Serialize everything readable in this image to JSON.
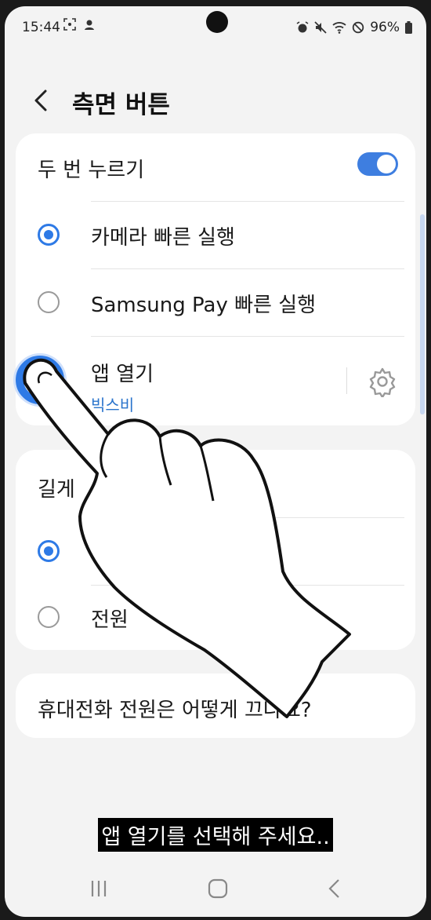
{
  "status_bar": {
    "time": "15:44",
    "left_icons": [
      "screenshot-icon",
      "bixby-icon"
    ],
    "right_icons": [
      "alarm-icon",
      "mute-icon",
      "wifi-icon",
      "do-not-disturb-icon"
    ],
    "battery_text": "96%"
  },
  "header": {
    "title": "측면 버튼"
  },
  "double_press": {
    "title": "두 번 누르기",
    "toggle_on": true,
    "options": [
      {
        "label": "카메라 빠른 실행",
        "selected": false
      },
      {
        "label": "Samsung Pay 빠른 실행",
        "selected": false
      },
      {
        "label": "앱 열기",
        "sublabel": "빅스비",
        "selected": true
      }
    ]
  },
  "press_and_hold": {
    "title": "길게",
    "options": [
      {
        "label": "",
        "selected": true
      },
      {
        "label": "전원",
        "selected": false
      }
    ]
  },
  "help_link": {
    "label": "휴대전화 전원은 어떻게 끄나요?"
  },
  "caption": {
    "text": "앱 열기를 선택해 주세요.."
  },
  "colors": {
    "accent": "#2e7ae6",
    "background": "#f3f3f3",
    "card": "#ffffff",
    "sublabel": "#2a74cc"
  }
}
